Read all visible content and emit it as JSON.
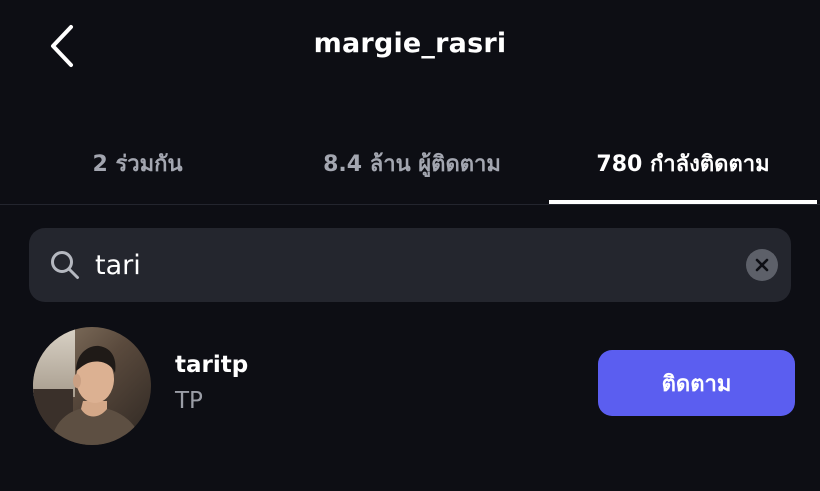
{
  "header": {
    "title": "margie_rasri",
    "back_icon": "chevron-left-icon"
  },
  "tabs": [
    {
      "label": "2 ร่วมกัน",
      "active": false
    },
    {
      "label": "8.4 ล้าน ผู้ติดตาม",
      "active": false
    },
    {
      "label": "780 กำลังติดตาม",
      "active": true
    }
  ],
  "search": {
    "value": "tari",
    "icon": "search-icon",
    "clear_icon": "clear-icon"
  },
  "results": [
    {
      "username": "taritp",
      "full_name": "TP",
      "button_label": "ติดตาม"
    }
  ],
  "colors": {
    "background": "#0d0e14",
    "search_background": "#24262e",
    "accent": "#5b5ef0",
    "muted_text": "#a3a6b0"
  }
}
